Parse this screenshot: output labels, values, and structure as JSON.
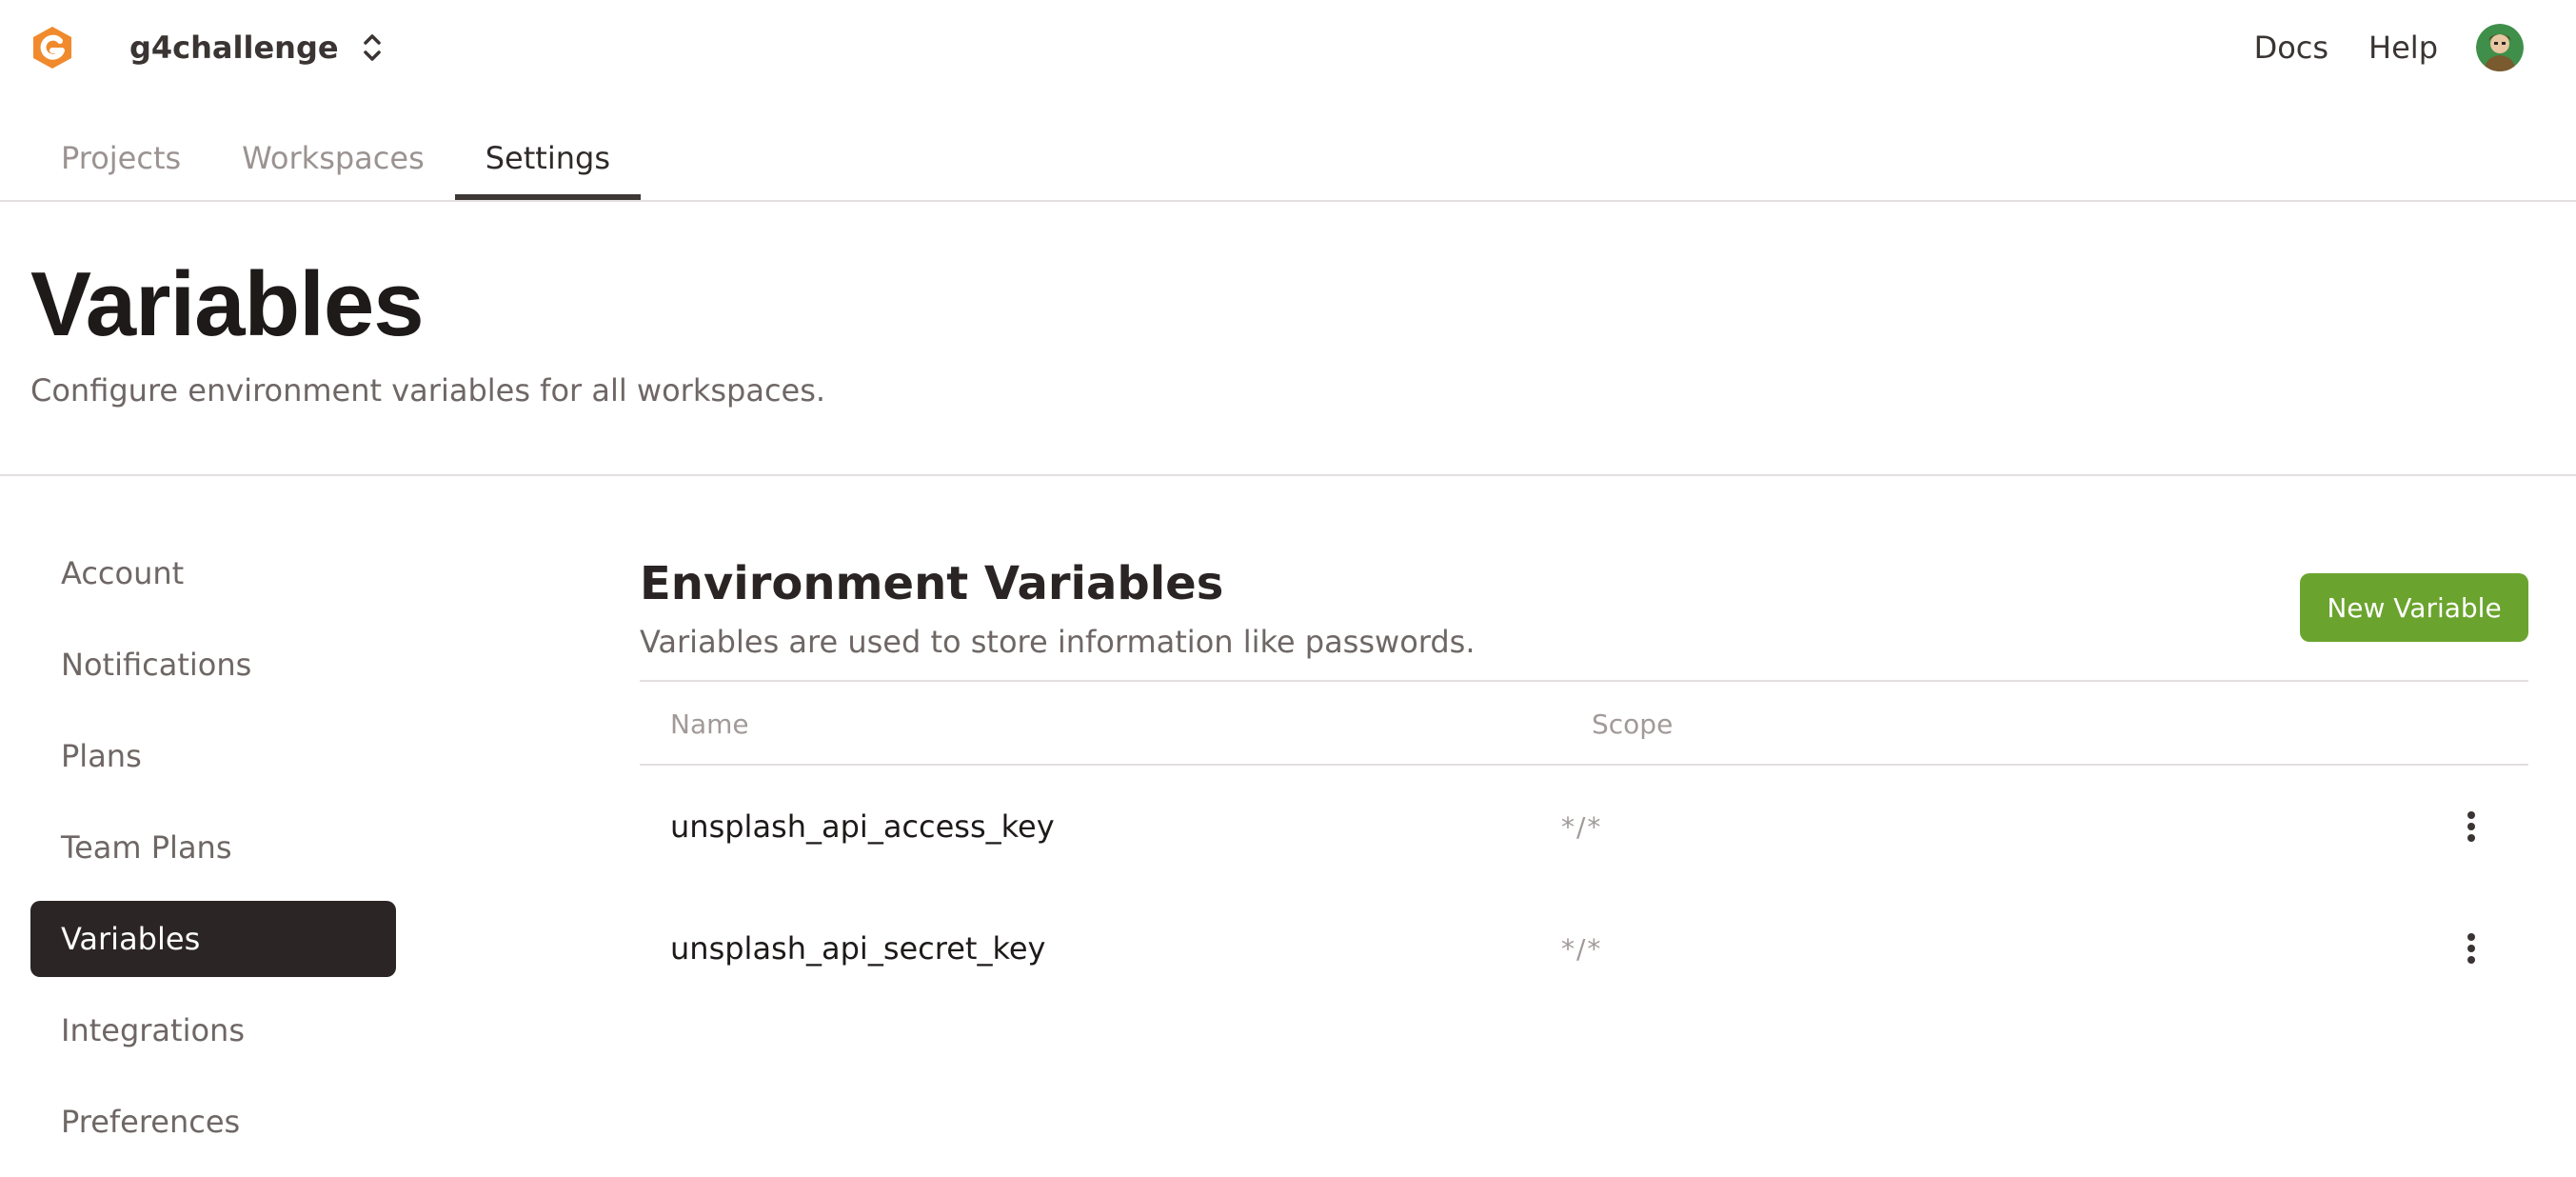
{
  "header": {
    "org_name": "g4challenge",
    "links": {
      "docs": "Docs",
      "help": "Help"
    },
    "colors": {
      "logo": "#f08a2c",
      "accent": "#6aa42e"
    }
  },
  "main_tabs": [
    {
      "label": "Projects",
      "active": false
    },
    {
      "label": "Workspaces",
      "active": false
    },
    {
      "label": "Settings",
      "active": true
    }
  ],
  "page": {
    "title": "Variables",
    "subtitle": "Configure environment variables for all workspaces."
  },
  "sidebar": {
    "items": [
      {
        "label": "Account",
        "active": false
      },
      {
        "label": "Notifications",
        "active": false
      },
      {
        "label": "Plans",
        "active": false
      },
      {
        "label": "Team Plans",
        "active": false
      },
      {
        "label": "Variables",
        "active": true
      },
      {
        "label": "Integrations",
        "active": false
      },
      {
        "label": "Preferences",
        "active": false
      }
    ]
  },
  "env_section": {
    "title": "Environment Variables",
    "description": "Variables are used to store information like passwords.",
    "new_button": "New Variable",
    "columns": {
      "name": "Name",
      "scope": "Scope"
    },
    "rows": [
      {
        "name": "unsplash_api_access_key",
        "scope": "*/*"
      },
      {
        "name": "unsplash_api_secret_key",
        "scope": "*/*"
      }
    ]
  }
}
